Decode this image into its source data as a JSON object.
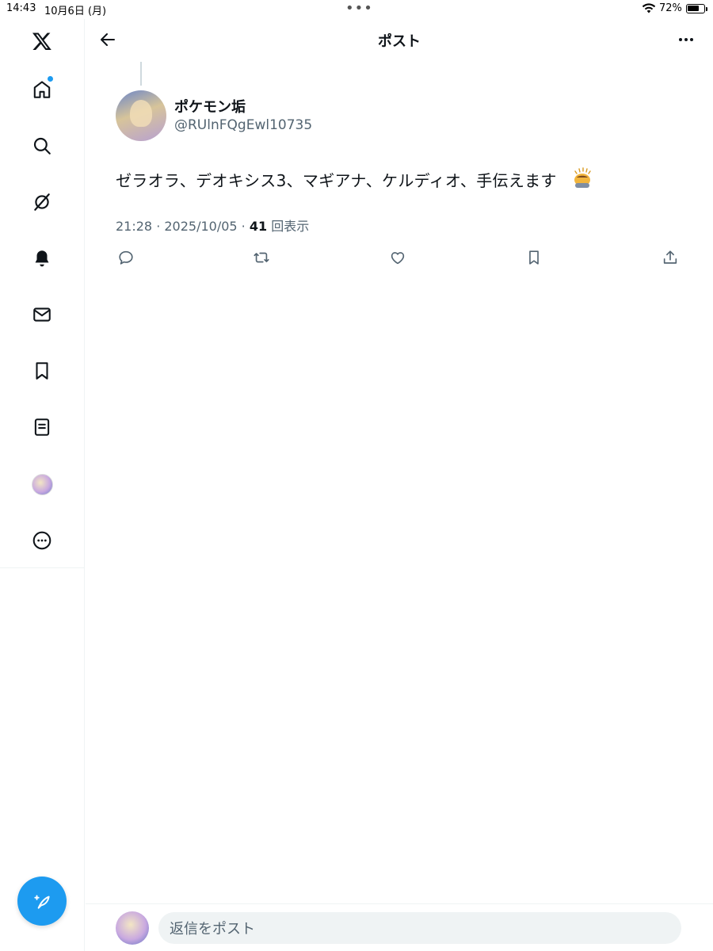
{
  "status_bar": {
    "time": "14:43",
    "date": "10月6日 (月)",
    "dots": "•••",
    "battery_percent": "72%",
    "battery_level": 0.72
  },
  "header": {
    "title": "ポスト"
  },
  "post": {
    "display_name": "ポケモン垢",
    "username": "@RUlnFQgEwl10735",
    "text": "ゼラオラ、デオキシス3、マギアナ、ケルディオ、手伝えます",
    "timestamp": "21:28 · 2025/10/05 · ",
    "views_count": "41",
    "views_label": " 回表示"
  },
  "reply": {
    "placeholder": "返信をポスト"
  },
  "colors": {
    "accent": "#1d9bf0",
    "text": "#0f1419",
    "secondary": "#536471",
    "border": "#eff3f4"
  },
  "icons": {
    "sidebar": [
      "x-logo-icon",
      "home-icon",
      "search-icon",
      "grok-icon",
      "notifications-icon",
      "messages-icon",
      "bookmarks-icon",
      "lists-icon",
      "profile-avatar",
      "more-icon"
    ],
    "actions": [
      "reply-icon",
      "repost-icon",
      "like-icon",
      "bookmark-icon",
      "share-icon"
    ]
  }
}
